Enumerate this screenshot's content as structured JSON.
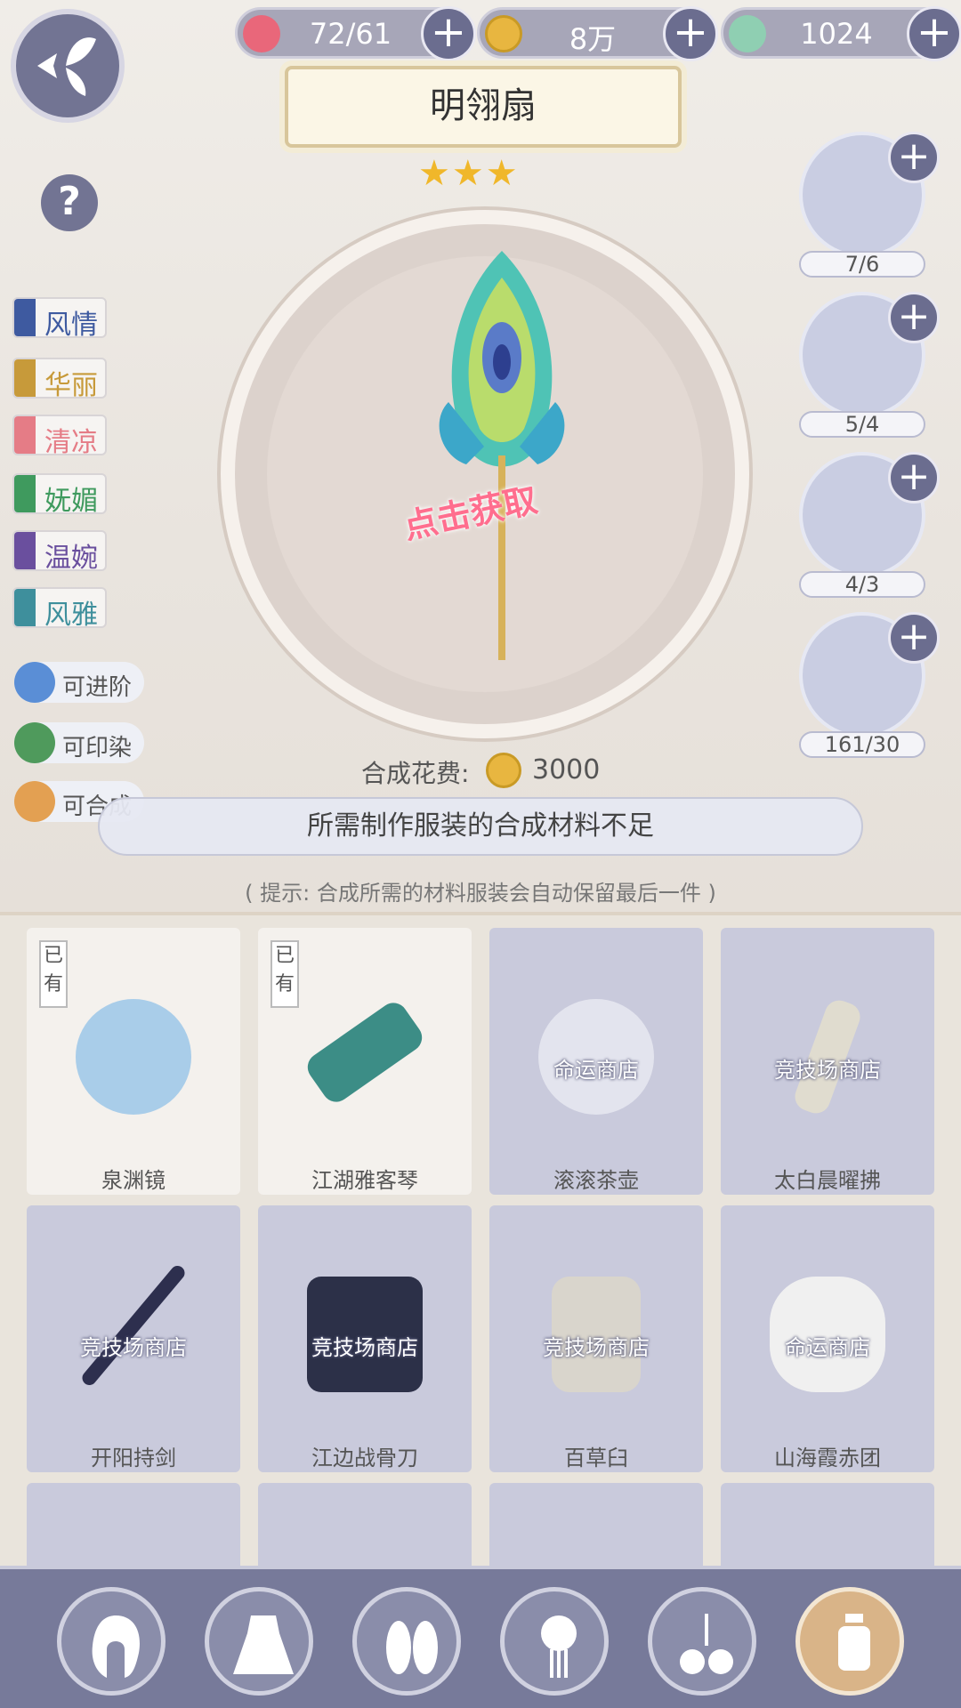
{
  "currency": {
    "stamina": "72/61",
    "coins": "8万",
    "gems": "1024"
  },
  "item_title": "明翎扇",
  "stars": "★★★",
  "claim_label": "点击获取",
  "tags": [
    "风情",
    "华丽",
    "清凉",
    "妩媚",
    "温婉",
    "风雅"
  ],
  "tag_colors": [
    "#3e5aa0",
    "#c79a3a",
    "#e57c86",
    "#3f9a5e",
    "#6a4f9e",
    "#3e8f9c"
  ],
  "features": [
    "可进阶",
    "可印染",
    "可合成"
  ],
  "materials": [
    "7/6",
    "5/4",
    "4/3",
    "161/30"
  ],
  "cost": {
    "label": "合成花费:",
    "value": "3000"
  },
  "toast": "所需制作服装的合成材料不足",
  "hint": "( 提示: 合成所需的材料服装会自动保留最后一件 )",
  "cards": [
    {
      "name": "泉渊镜",
      "badge": "已有",
      "shop": ""
    },
    {
      "name": "江湖雅客琴",
      "badge": "已有",
      "shop": ""
    },
    {
      "name": "滚滚茶壶",
      "badge": "",
      "shop": "命运商店"
    },
    {
      "name": "太白晨曜拂",
      "badge": "",
      "shop": "竞技场商店"
    },
    {
      "name": "开阳持剑",
      "badge": "",
      "shop": "竞技场商店"
    },
    {
      "name": "江边战骨刀",
      "badge": "",
      "shop": "竞技场商店"
    },
    {
      "name": "百草臼",
      "badge": "",
      "shop": "竞技场商店"
    },
    {
      "name": "山海霞赤团",
      "badge": "",
      "shop": "命运商店"
    }
  ],
  "colors": {
    "accent": "#6b6d8f",
    "gold": "#e8b640",
    "pink": "#ff6e8e"
  },
  "nav_icons": [
    "hair-icon",
    "dress-icon",
    "shoes-icon",
    "hairpin-icon",
    "accessory-icon",
    "lantern-icon"
  ]
}
